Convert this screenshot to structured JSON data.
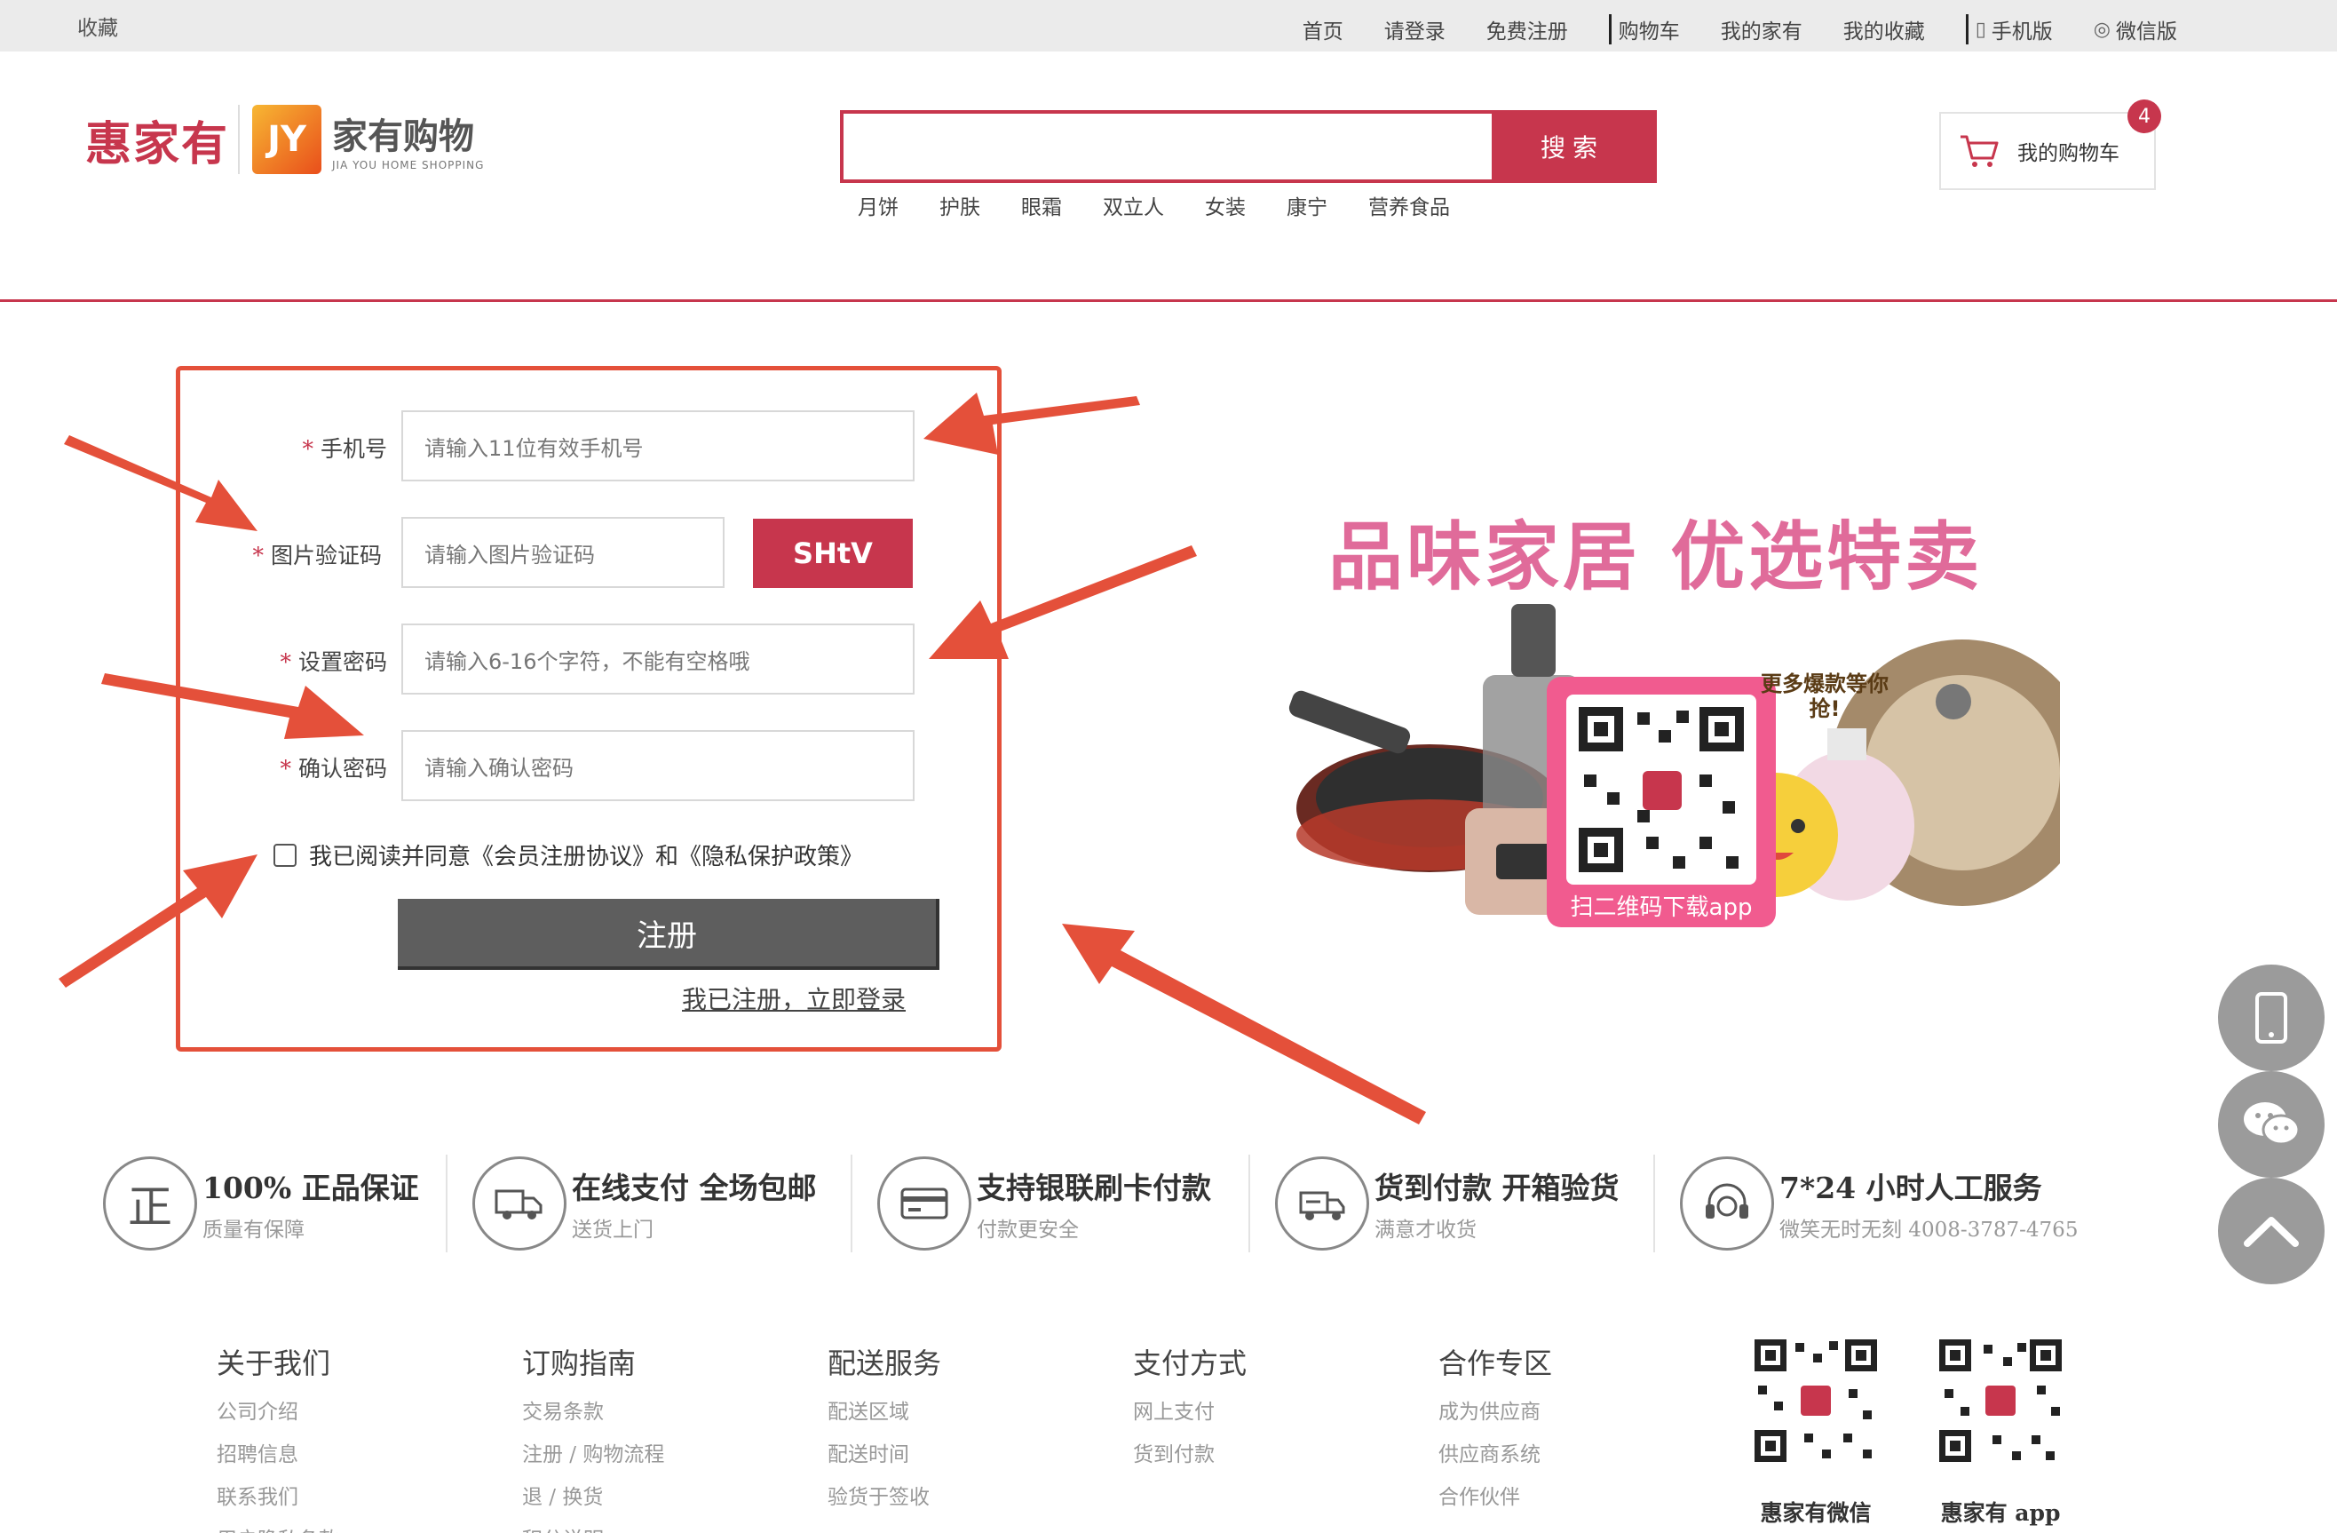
{
  "topbar": {
    "favorite": "收藏",
    "nav": [
      "首页",
      "请登录",
      "免费注册"
    ],
    "cart": "购物车",
    "my_home": "我的家有",
    "my_fav": "我的收藏",
    "mobile": "手机版",
    "wechat": "微信版"
  },
  "header": {
    "brand": "惠家有",
    "jy_mark": "JY",
    "jy_name": "家有购物",
    "jy_en": "JIA YOU HOME SHOPPING",
    "search_button": "搜索",
    "hot_words": [
      "月饼",
      "护肤",
      "眼霜",
      "双立人",
      "女装",
      "康宁",
      "营养食品"
    ],
    "cart_label": "我的购物车",
    "cart_count": "4"
  },
  "form": {
    "required_mark": "*",
    "phone_label": "手机号",
    "phone_placeholder": "请输入11位有效手机号",
    "captcha_label": "图片验证码",
    "captcha_placeholder": "请输入图片验证码",
    "captcha_text": "SHtV",
    "password_label": "设置密码",
    "password_placeholder": "请输入6-16个字符，不能有空格哦",
    "confirm_label": "确认密码",
    "confirm_placeholder": "请输入确认密码",
    "agree_text": "我已阅读并同意《会员注册协议》和《隐私保护政策》",
    "register_button": "注册",
    "login_link": "我已注册，立即登录"
  },
  "promo": {
    "title": "品味家居  优选特卖",
    "badge": "更多爆款等你抢!",
    "qr_caption": "扫二维码下载app"
  },
  "services": [
    {
      "icon": "genuine-icon",
      "title": "100% 正品保证",
      "sub": "质量有保障"
    },
    {
      "icon": "truck-icon",
      "title": "在线支付 全场包邮",
      "sub": "送货上门"
    },
    {
      "icon": "card-icon",
      "title": "支持银联刷卡付款",
      "sub": "付款更安全"
    },
    {
      "icon": "cod-icon",
      "title": "货到付款 开箱验货",
      "sub": "满意才收货"
    },
    {
      "icon": "headset-icon",
      "title": "7*24 小时人工服务",
      "sub": "微笑无时无刻 4008-3787-4765"
    }
  ],
  "footer": {
    "columns": [
      {
        "title": "关于我们",
        "items": [
          "公司介绍",
          "招聘信息",
          "联系我们",
          "用户隐私条款"
        ]
      },
      {
        "title": "订购指南",
        "items": [
          "交易条款",
          "注册 / 购物流程",
          "退 / 换货",
          "积分说明"
        ]
      },
      {
        "title": "配送服务",
        "items": [
          "配送区域",
          "配送时间",
          "验货于签收"
        ]
      },
      {
        "title": "支付方式",
        "items": [
          "网上支付",
          "货到付款"
        ]
      },
      {
        "title": "合作专区",
        "items": [
          "成为供应商",
          "供应商系统",
          "合作伙伴"
        ]
      }
    ],
    "qr_wechat": "惠家有微信",
    "qr_app": "惠家有 app"
  },
  "colors": {
    "brand": "#c7364d",
    "annotation": "#e4503a"
  }
}
